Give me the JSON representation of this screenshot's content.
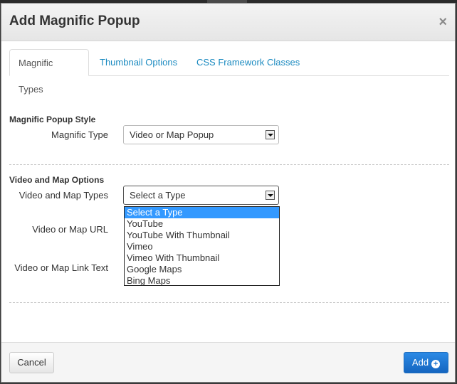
{
  "dialog": {
    "title": "Add Magnific Popup",
    "close_symbol": "×"
  },
  "tabs": [
    {
      "label": "Magnific Types",
      "active": true
    },
    {
      "label": "Thumbnail Options",
      "active": false
    },
    {
      "label": "CSS Framework Classes",
      "active": false
    }
  ],
  "style_section": {
    "title": "Magnific Popup Style",
    "type_label": "Magnific Type",
    "type_value": "Video or Map Popup"
  },
  "video_section": {
    "title": "Video and Map Options",
    "types_label": "Video and Map Types",
    "types_value": "Select a Type",
    "url_label": "Video or Map URL",
    "link_text_label": "Video or Map Link Text"
  },
  "dropdown": {
    "options": [
      "Select a Type",
      "YouTube",
      "YouTube With Thumbnail",
      "Vimeo",
      "Vimeo With Thumbnail",
      "Google Maps",
      "Bing Maps"
    ],
    "selected_index": 0
  },
  "footer": {
    "cancel_label": "Cancel",
    "add_label": "Add",
    "add_icon": "plus-circle-icon"
  },
  "colors": {
    "link": "#1a8ac0",
    "primary_button": "#1a73cf",
    "selected_option": "#3399ff"
  }
}
